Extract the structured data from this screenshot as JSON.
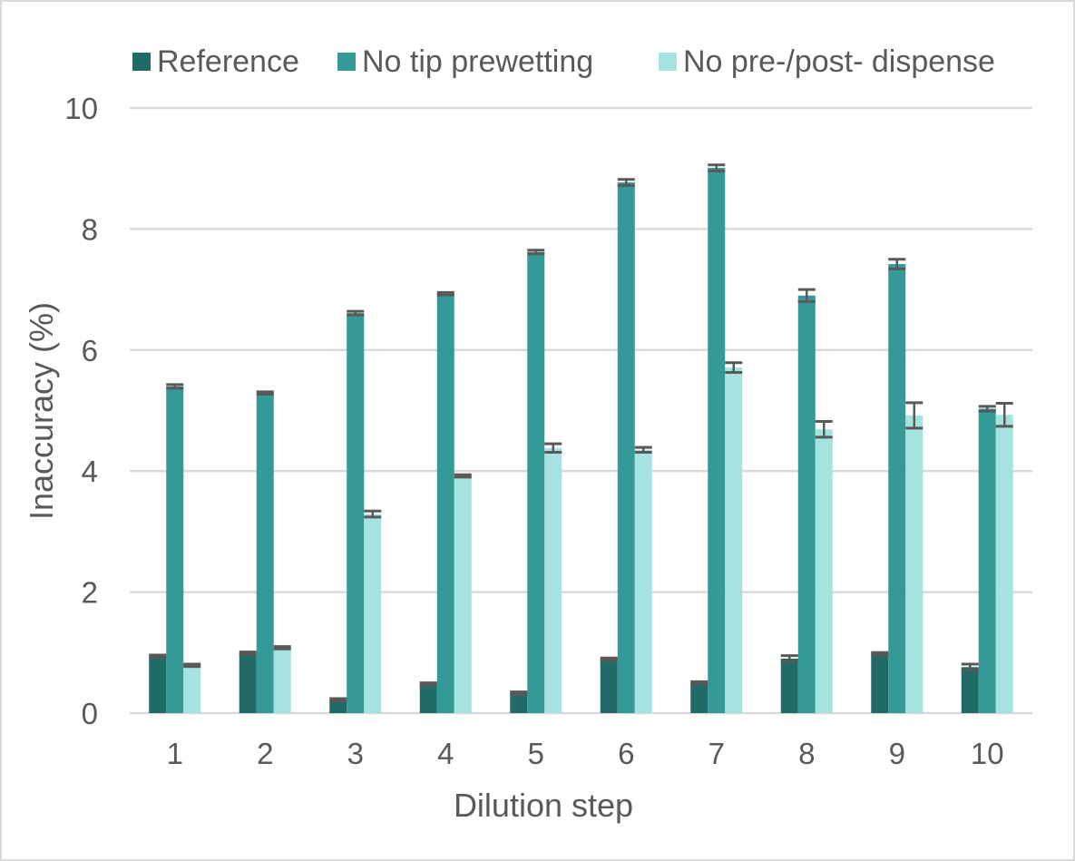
{
  "chart_data": {
    "type": "bar",
    "title": "",
    "xlabel": "Dilution step",
    "ylabel": "Inaccuracy (%)",
    "ylim": [
      0,
      10
    ],
    "yticks": [
      0,
      2,
      4,
      6,
      8,
      10
    ],
    "grid": true,
    "legend_position": "top",
    "categories": [
      "1",
      "2",
      "3",
      "4",
      "5",
      "6",
      "7",
      "8",
      "9",
      "10"
    ],
    "series": [
      {
        "name": "Reference",
        "color": "#206a67",
        "values": [
          0.94,
          0.99,
          0.22,
          0.48,
          0.33,
          0.89,
          0.5,
          0.9,
          0.98,
          0.76
        ],
        "errors": [
          0.02,
          0.02,
          0.02,
          0.02,
          0.02,
          0.02,
          0.02,
          0.05,
          0.02,
          0.05
        ]
      },
      {
        "name": "No tip prewetting",
        "color": "#339a98",
        "values": [
          5.4,
          5.29,
          6.61,
          6.93,
          7.62,
          8.77,
          9.01,
          6.9,
          7.42,
          5.03
        ],
        "errors": [
          0.03,
          0.02,
          0.03,
          0.02,
          0.03,
          0.05,
          0.05,
          0.1,
          0.08,
          0.04
        ]
      },
      {
        "name": "No pre-/post- dispense",
        "color": "#a6e2e0",
        "values": [
          0.79,
          1.08,
          3.29,
          3.92,
          4.38,
          4.35,
          5.71,
          4.69,
          4.92,
          4.93
        ],
        "errors": [
          0.02,
          0.02,
          0.05,
          0.02,
          0.07,
          0.04,
          0.08,
          0.13,
          0.21,
          0.19
        ]
      }
    ],
    "error_bar_color": "#595959",
    "gridline_color": "#d9d9d9"
  }
}
